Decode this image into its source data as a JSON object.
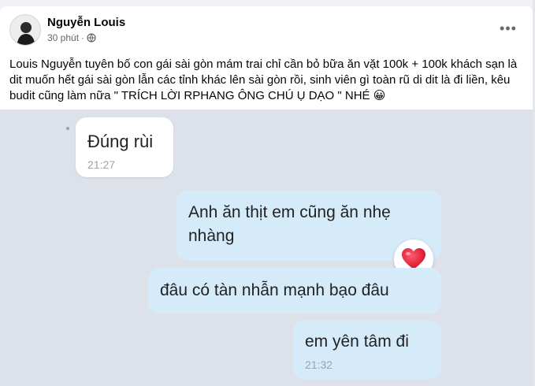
{
  "post": {
    "author": "Nguyễn Louis",
    "time": "30 phút",
    "separator": "·",
    "visibility_icon": "globe-icon",
    "more_icon": "more-options-icon",
    "more_label": "•••",
    "text": "Louis Nguyễn tuyên bố con gái sài gòn mám trai chỉ cần bỏ bữa ăn vặt 100k + 100k khách sạn là dit muốn hết gái sài gòn lẫn các tỉnh khác lên sài gòn rồi, sinh viên gì toàn rũ di dit là đi liền, kêu budit cũng làm nữa \" TRÍCH LỜI RPHANG ÔNG CHÚ Ụ DẠO \" NHÉ 😀"
  },
  "chat": {
    "incoming": [
      {
        "text": "Đúng rùi",
        "time": "21:27"
      }
    ],
    "outgoing": [
      {
        "text": "Anh ăn thịt em cũng ăn nhẹ nhàng",
        "time": ""
      },
      {
        "text": "đâu có tàn nhẫn mạnh bạo đâu",
        "time": ""
      },
      {
        "text": "em yên tâm đi",
        "time": "21:32"
      }
    ],
    "reaction_icon": "heart-icon"
  },
  "colors": {
    "page_bg": "#f0f2f5",
    "card_bg": "#ffffff",
    "outgoing_bubble": "#d6ebfa",
    "chat_bg": "#dde1ea",
    "heart": "#e8112d",
    "muted_text": "#65676b"
  }
}
